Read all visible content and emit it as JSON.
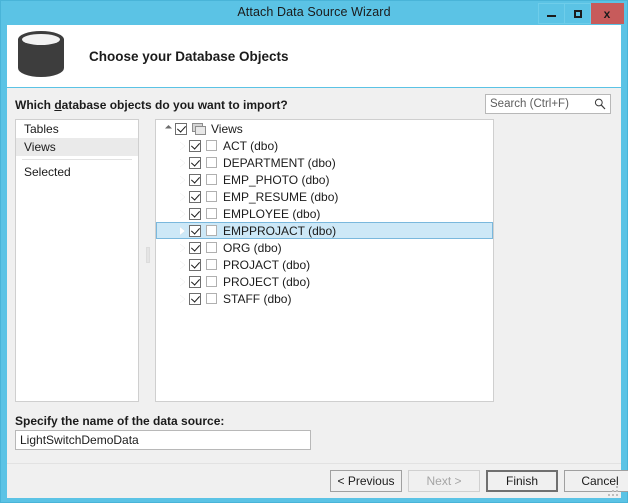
{
  "window": {
    "title": "Attach Data Source Wizard",
    "accent_color": "#5bc3e5",
    "close_color": "#c75b5b",
    "buttons": {
      "minimize": "minimize-icon",
      "maximize": "maximize-icon",
      "close": "x"
    }
  },
  "header": {
    "icon": "database-cylinder-icon",
    "title": "Choose your Database Objects"
  },
  "main": {
    "prompt_before": "Which ",
    "prompt_accel": "d",
    "prompt_after": "atabase objects do you want to import?",
    "prompt_full": "Which database objects do you want to import?"
  },
  "search": {
    "placeholder": "Search (Ctrl+F)",
    "value": "",
    "icon": "search-icon"
  },
  "object_types": {
    "items": [
      {
        "label": "Tables",
        "selected": false
      },
      {
        "label": "Views",
        "selected": true
      },
      {
        "label": "Selected",
        "selected": false
      }
    ]
  },
  "tree": {
    "root": {
      "label": "Views",
      "checked": true,
      "expanded": true,
      "icon": "views-stack-icon"
    },
    "nodes": [
      {
        "label": "ACT (dbo)",
        "checked": true,
        "selected": false,
        "icon": "view-square-icon"
      },
      {
        "label": "DEPARTMENT (dbo)",
        "checked": true,
        "selected": false,
        "icon": "view-square-icon"
      },
      {
        "label": "EMP_PHOTO (dbo)",
        "checked": true,
        "selected": false,
        "icon": "view-square-icon"
      },
      {
        "label": "EMP_RESUME (dbo)",
        "checked": true,
        "selected": false,
        "icon": "view-square-icon"
      },
      {
        "label": "EMPLOYEE (dbo)",
        "checked": true,
        "selected": false,
        "icon": "view-square-icon"
      },
      {
        "label": "EMPPROJACT (dbo)",
        "checked": true,
        "selected": true,
        "icon": "view-square-icon"
      },
      {
        "label": "ORG (dbo)",
        "checked": true,
        "selected": false,
        "icon": "view-square-icon"
      },
      {
        "label": "PROJACT (dbo)",
        "checked": true,
        "selected": false,
        "icon": "view-square-icon"
      },
      {
        "label": "PROJECT (dbo)",
        "checked": true,
        "selected": false,
        "icon": "view-square-icon"
      },
      {
        "label": "STAFF (dbo)",
        "checked": true,
        "selected": false,
        "icon": "view-square-icon"
      }
    ]
  },
  "data_source": {
    "label": "Specify the name of the data source:",
    "value": "LightSwitchDemoData",
    "placeholder": ""
  },
  "footer": {
    "previous": {
      "label": "< Previous",
      "accel": "P",
      "disabled": false,
      "default": false
    },
    "next": {
      "label": "Next >",
      "accel": "N",
      "disabled": true,
      "default": false
    },
    "finish": {
      "label": "Finish",
      "accel": "F",
      "disabled": false,
      "default": true
    },
    "cancel": {
      "label": "Cancel",
      "accel": "",
      "disabled": false,
      "default": false
    }
  }
}
